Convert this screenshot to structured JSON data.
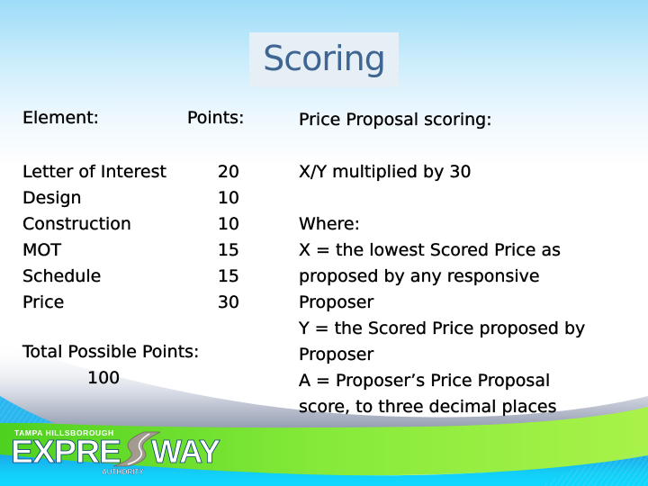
{
  "slide": {
    "title": "Scoring",
    "left_column": {
      "element_header": "Element:",
      "points_header": "Points:",
      "rows": [
        {
          "element": "Letter of Interest",
          "points": "20"
        },
        {
          "element": "Design",
          "points": "10"
        },
        {
          "element": "Construction",
          "points": "10"
        },
        {
          "element": "MOT",
          "points": "15"
        },
        {
          "element": "Schedule",
          "points": "15"
        },
        {
          "element": "Price",
          "points": "30"
        }
      ],
      "total_label": "Total Possible Points:",
      "total_value": "100"
    },
    "right_column": {
      "header": "Price Proposal scoring:",
      "formula": "X/Y multiplied by 30",
      "where_lines": [
        "Where:",
        "X = the lowest Scored Price as",
        "proposed by any responsive",
        "Proposer",
        "Y = the Scored Price proposed by",
        "Proposer",
        "A = Proposer’s Price Proposal",
        "score, to three decimal places"
      ]
    }
  },
  "logo": {
    "top_text": "TAMPA HILLSBOROUGH",
    "main_left": "EXPRE",
    "main_right": "WAY",
    "bottom_text": "AUTHORITY"
  },
  "colors": {
    "title_text": "#3f6593",
    "title_bg": "#e6eff6",
    "green_band": "#7de83a",
    "blue_band": "#1fb8f0",
    "body_text": "#000000"
  }
}
